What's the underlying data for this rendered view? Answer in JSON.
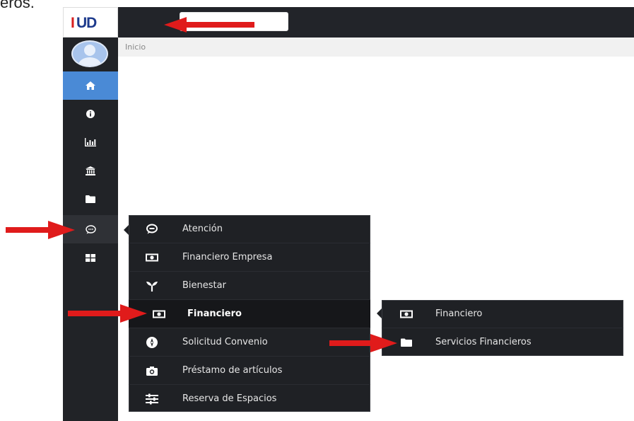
{
  "cutoff_text": "eros.",
  "brand": {
    "logo_first": "I",
    "logo_rest": "UD"
  },
  "breadcrumb": {
    "current": "Inicio"
  },
  "sidebar": {
    "items": [
      {
        "icon": "home-icon"
      },
      {
        "icon": "info-icon"
      },
      {
        "icon": "bar-chart-icon"
      },
      {
        "icon": "bank-icon"
      },
      {
        "icon": "folder-icon"
      },
      {
        "icon": "chat-icon"
      },
      {
        "icon": "grid-icon"
      }
    ]
  },
  "menu": {
    "items": [
      {
        "label": "Atención",
        "icon": "chat-icon"
      },
      {
        "label": "Financiero Empresa",
        "icon": "money-icon"
      },
      {
        "label": "Bienestar",
        "icon": "sprout-icon"
      },
      {
        "label": "Financiero",
        "icon": "money-icon"
      },
      {
        "label": "Solicitud Convenio",
        "icon": "compass-icon"
      },
      {
        "label": "Préstamo de artículos",
        "icon": "camera-icon"
      },
      {
        "label": "Reserva de Espacios",
        "icon": "sliders-icon"
      }
    ]
  },
  "submenu": {
    "items": [
      {
        "label": "Financiero",
        "icon": "money-icon"
      },
      {
        "label": "Servicios Financieros",
        "icon": "folder-icon"
      }
    ]
  },
  "colors": {
    "sidebar_bg": "#212327",
    "topbar_bg": "#222429",
    "active_home": "#4a8ad6",
    "menu_bg": "#1f2125",
    "annotation_arrow": "#e01b1b",
    "logo_red": "#d81e1e",
    "logo_blue": "#1d3a8c"
  }
}
